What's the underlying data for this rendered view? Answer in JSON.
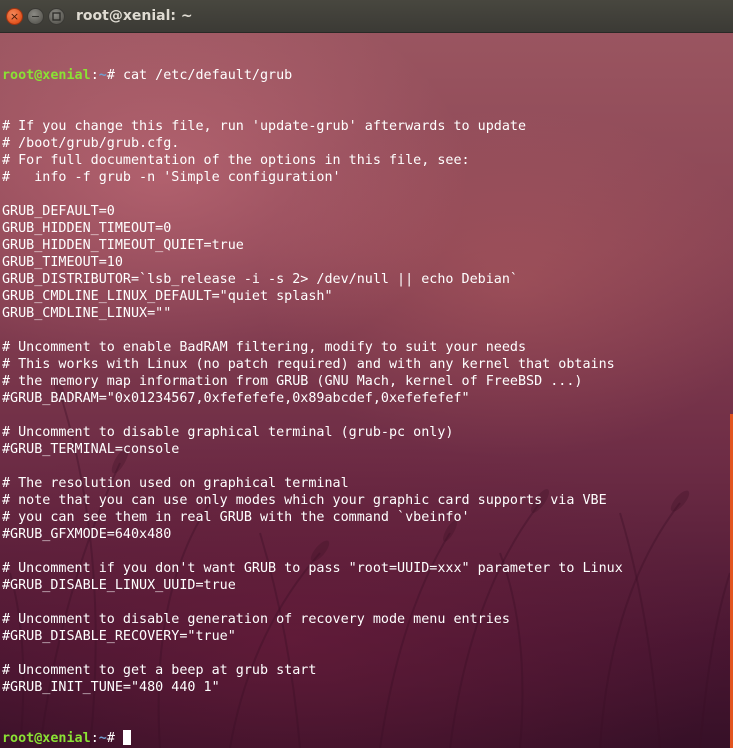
{
  "window": {
    "title": "root@xenial: ~",
    "close_glyph": "×",
    "min_glyph": "−"
  },
  "colors": {
    "prompt_user": "#8ae234",
    "prompt_path": "#729fcf",
    "text": "#ffffff",
    "titlebar": "#3e3d38",
    "scrollbar": "#e2541f"
  },
  "prompt": {
    "user_host": "root@xenial",
    "separator": ":",
    "path": "~",
    "symbol": "# "
  },
  "command": "cat /etc/default/grub",
  "output_lines": [
    "# If you change this file, run 'update-grub' afterwards to update",
    "# /boot/grub/grub.cfg.",
    "# For full documentation of the options in this file, see:",
    "#   info -f grub -n 'Simple configuration'",
    "",
    "GRUB_DEFAULT=0",
    "GRUB_HIDDEN_TIMEOUT=0",
    "GRUB_HIDDEN_TIMEOUT_QUIET=true",
    "GRUB_TIMEOUT=10",
    "GRUB_DISTRIBUTOR=`lsb_release -i -s 2> /dev/null || echo Debian`",
    "GRUB_CMDLINE_LINUX_DEFAULT=\"quiet splash\"",
    "GRUB_CMDLINE_LINUX=\"\"",
    "",
    "# Uncomment to enable BadRAM filtering, modify to suit your needs",
    "# This works with Linux (no patch required) and with any kernel that obtains",
    "# the memory map information from GRUB (GNU Mach, kernel of FreeBSD ...)",
    "#GRUB_BADRAM=\"0x01234567,0xfefefefe,0x89abcdef,0xefefefef\"",
    "",
    "# Uncomment to disable graphical terminal (grub-pc only)",
    "#GRUB_TERMINAL=console",
    "",
    "# The resolution used on graphical terminal",
    "# note that you can use only modes which your graphic card supports via VBE",
    "# you can see them in real GRUB with the command `vbeinfo'",
    "#GRUB_GFXMODE=640x480",
    "",
    "# Uncomment if you don't want GRUB to pass \"root=UUID=xxx\" parameter to Linux",
    "#GRUB_DISABLE_LINUX_UUID=true",
    "",
    "# Uncomment to disable generation of recovery mode menu entries",
    "#GRUB_DISABLE_RECOVERY=\"true\"",
    "",
    "# Uncomment to get a beep at grub start",
    "#GRUB_INIT_TUNE=\"480 440 1\""
  ]
}
